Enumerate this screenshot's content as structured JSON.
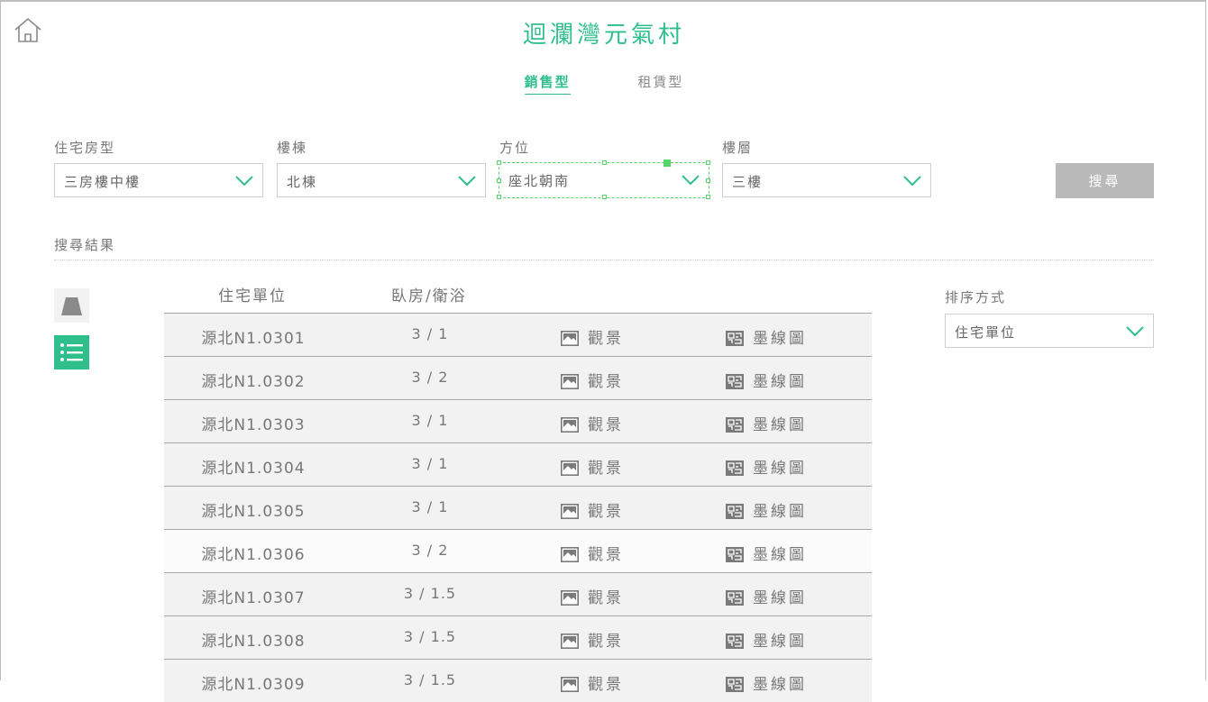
{
  "header": {
    "title": "迴瀾灣元氣村",
    "home_icon": "home-icon",
    "accent_color": "#2fbf8c"
  },
  "tabs": [
    {
      "label": "銷售型",
      "active": true
    },
    {
      "label": "租賃型",
      "active": false
    }
  ],
  "filters": {
    "house_type": {
      "label": "住宅房型",
      "value": "三房樓中樓"
    },
    "building": {
      "label": "樓棟",
      "value": "北棟"
    },
    "orientation": {
      "label": "方位",
      "value": "座北朝南"
    },
    "floor": {
      "label": "樓層",
      "value": "三樓"
    },
    "search_label": "搜尋"
  },
  "results": {
    "label": "搜尋結果",
    "columns": {
      "unit": "住宅單位",
      "rooms": "臥房/衛浴"
    },
    "view_label": "觀景",
    "floorplan_label": "墨線圖",
    "rows": [
      {
        "unit": "源北N1.0301",
        "rooms": "3 / 1"
      },
      {
        "unit": "源北N1.0302",
        "rooms": "3 / 2"
      },
      {
        "unit": "源北N1.0303",
        "rooms": "3 / 1"
      },
      {
        "unit": "源北N1.0304",
        "rooms": "3 / 1"
      },
      {
        "unit": "源北N1.0305",
        "rooms": "3 / 1"
      },
      {
        "unit": "源北N1.0306",
        "rooms": "3 / 2"
      },
      {
        "unit": "源北N1.0307",
        "rooms": "3 / 1.5"
      },
      {
        "unit": "源北N1.0308",
        "rooms": "3 / 1.5"
      },
      {
        "unit": "源北N1.0309",
        "rooms": "3 / 1.5"
      }
    ]
  },
  "sort": {
    "label": "排序方式",
    "value": "住宅單位"
  }
}
